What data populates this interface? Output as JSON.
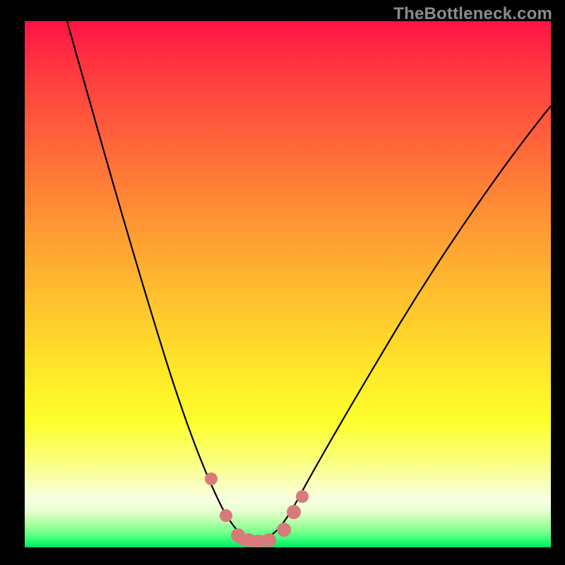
{
  "watermark": "TheBottleneck.com",
  "chart_data": {
    "type": "line",
    "title": "",
    "xlabel": "",
    "ylabel": "",
    "xlim": [
      0,
      100
    ],
    "ylim": [
      0,
      100
    ],
    "series": [
      {
        "name": "bottleneck-curve",
        "x": [
          8,
          12,
          16,
          20,
          24,
          28,
          31,
          34,
          36,
          38,
          40,
          42,
          44,
          46,
          48,
          51,
          55,
          60,
          66,
          73,
          81,
          90,
          100
        ],
        "y": [
          100,
          86,
          74,
          62,
          50,
          38,
          28,
          19,
          13,
          8,
          4,
          2,
          1,
          1,
          2,
          4,
          8,
          14,
          22,
          32,
          43,
          55,
          68
        ]
      }
    ],
    "markers": {
      "name": "highlighted-points",
      "color": "#d97a7a",
      "x": [
        35.5,
        38.3,
        40.5,
        42.5,
        44.5,
        46.5,
        49.2,
        51.2,
        52.8
      ],
      "y": [
        13.0,
        6.0,
        2.2,
        1.0,
        1.0,
        1.2,
        3.2,
        6.5,
        9.5
      ]
    },
    "background_gradient": {
      "top": "#ff1344",
      "mid_upper": "#ff9534",
      "mid": "#ffe629",
      "lower": "#f9ffc2",
      "bottom": "#00e56a"
    }
  }
}
